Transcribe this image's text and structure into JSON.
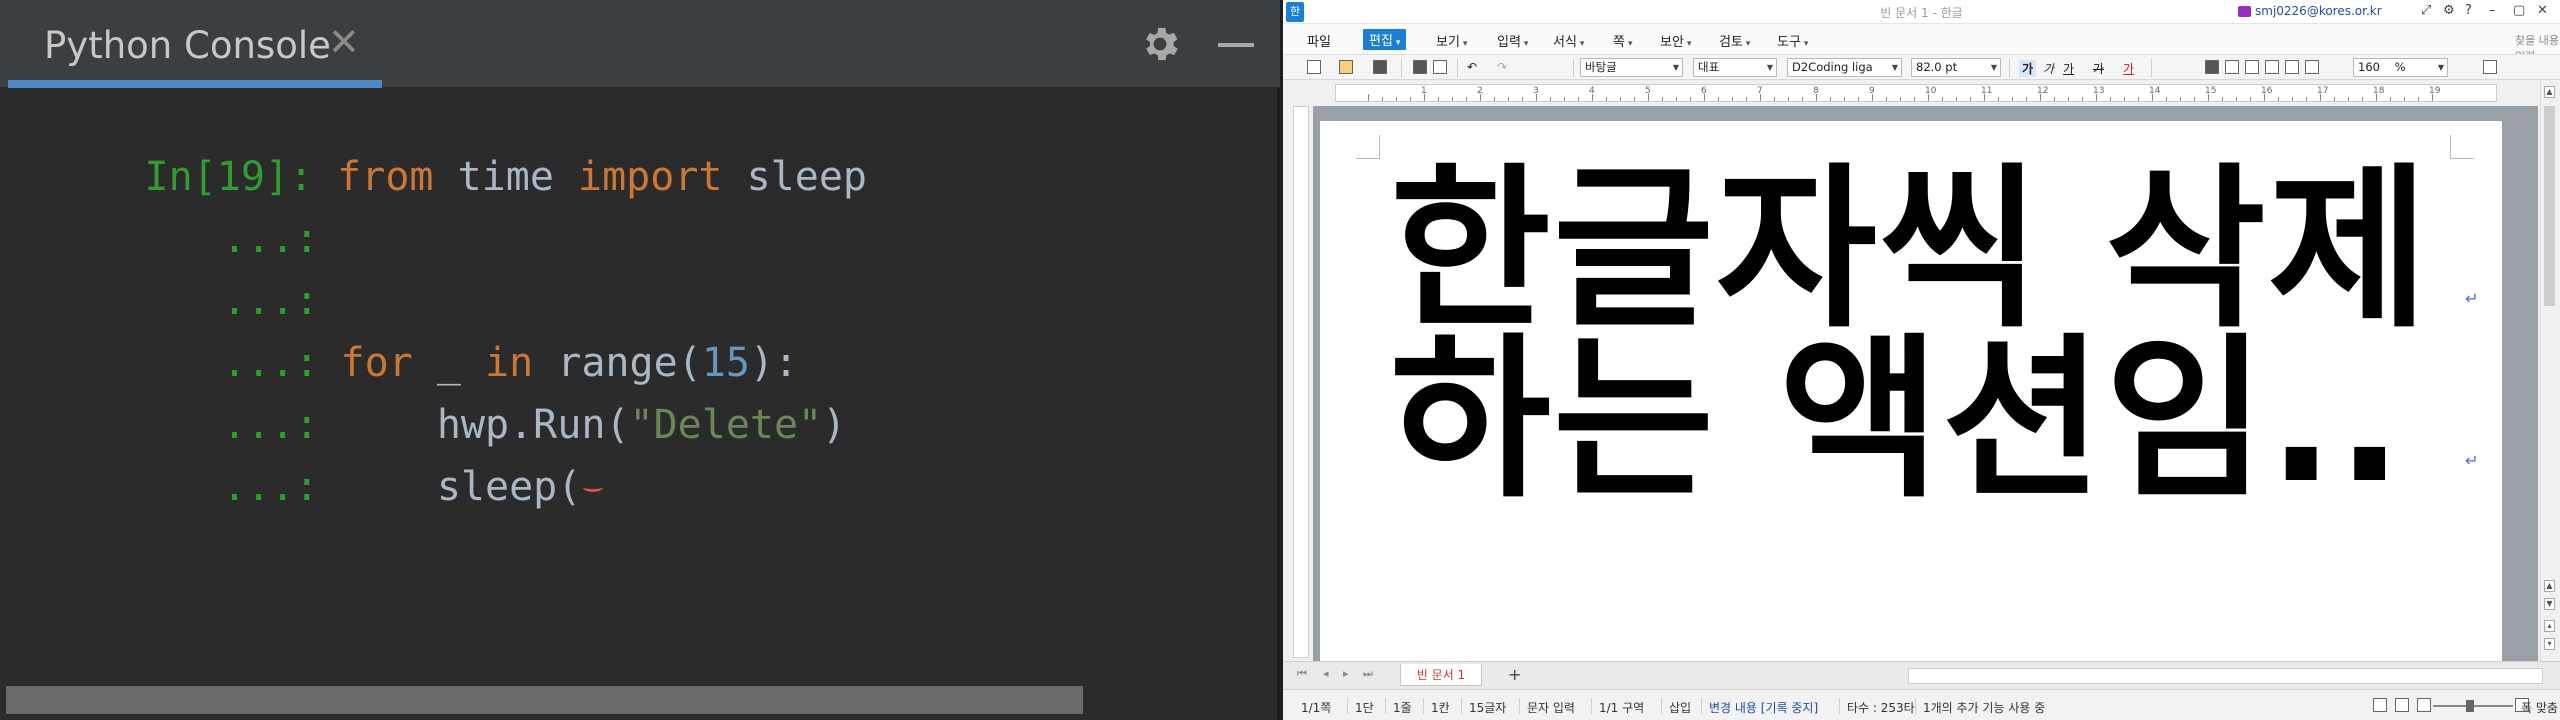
{
  "console": {
    "tab_title": "Python Console",
    "tab_close": "✕",
    "icons": [
      "gear-icon",
      "minimize-icon"
    ],
    "lines": [
      {
        "prompt": "In[19]:",
        "tokens": [
          {
            "t": "kw",
            "v": "from"
          },
          {
            "t": "id",
            "v": " time "
          },
          {
            "t": "kw",
            "v": "import"
          },
          {
            "t": "id",
            "v": " sleep"
          }
        ]
      },
      {
        "prompt": "...:",
        "tokens": []
      },
      {
        "prompt": "...:",
        "tokens": []
      },
      {
        "prompt": "...:",
        "tokens": [
          {
            "t": "kw",
            "v": "for"
          },
          {
            "t": "id",
            "v": " _ "
          },
          {
            "t": "kw",
            "v": "in"
          },
          {
            "t": "id",
            "v": " range("
          },
          {
            "t": "num",
            "v": "15"
          },
          {
            "t": "id",
            "v": "):"
          }
        ]
      },
      {
        "prompt": "...:",
        "tokens": [
          {
            "t": "id",
            "v": "    hwp.Run("
          },
          {
            "t": "str",
            "v": "\"Delete\""
          },
          {
            "t": "id",
            "v": ")"
          }
        ]
      },
      {
        "prompt": "...:",
        "tokens": [
          {
            "t": "id",
            "v": "    sleep("
          }
        ],
        "error_squiggle": true
      }
    ],
    "colors": {
      "keyword": "#cc7832",
      "identifier": "#a9b7c6",
      "number": "#6897bb",
      "string": "#6a8759",
      "prompt": "#2e9e2e"
    }
  },
  "hwp": {
    "doc_title": "빈 문서 1 - 한글",
    "user": "smj0226@kores.or.kr",
    "menu": [
      {
        "label": "파일",
        "caret": false,
        "active": false
      },
      {
        "label": "편집",
        "caret": true,
        "active": true
      },
      {
        "label": "보기",
        "caret": true,
        "active": false
      },
      {
        "label": "입력",
        "caret": true,
        "active": false
      },
      {
        "label": "서식",
        "caret": true,
        "active": false
      },
      {
        "label": "쪽",
        "caret": true,
        "active": false
      },
      {
        "label": "보안",
        "caret": true,
        "active": false
      },
      {
        "label": "검토",
        "caret": true,
        "active": false
      },
      {
        "label": "도구",
        "caret": true,
        "active": false
      }
    ],
    "menu_right": "찾을 내용 입력",
    "toolbar": {
      "style": "바탕글",
      "lang": "대표",
      "font": "D2Coding liga",
      "size": "82.0",
      "size_unit": "pt",
      "char_bold": "가",
      "char_italic": "가",
      "char_under": "가",
      "char_strike": "가",
      "char_color": "가",
      "zoom": "160",
      "zoom_unit": "%"
    },
    "ruler_numbers": [
      "1",
      "2",
      "3",
      "4",
      "5",
      "6",
      "7",
      "8",
      "9",
      "10",
      "11",
      "12",
      "13",
      "14",
      "15",
      "16",
      "17",
      "18",
      "19"
    ],
    "document_lines": [
      "한글자씩 삭제",
      "하는 액션임.."
    ],
    "doc_tab": "빈 문서 1",
    "add_tab": "+",
    "status": {
      "page": "1/1쪽",
      "column": "1단",
      "line": "1줄",
      "col": "1칸",
      "chars": "15글자",
      "mode": "문자 입력",
      "section": "1/1 구역",
      "insert": "삽입",
      "track": "변경 내용 [기록 중지]",
      "typing": "타수 : 253타",
      "extra": "1개의 추가 기능 사용 중",
      "fit": "폭 맞춤"
    }
  }
}
